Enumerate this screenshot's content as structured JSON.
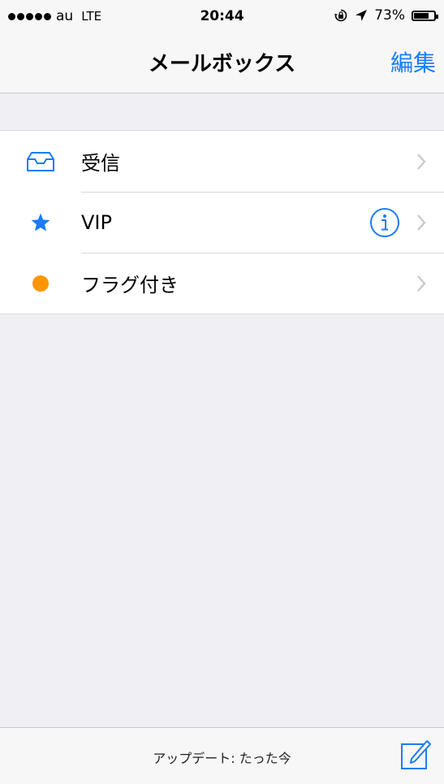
{
  "status_bar": {
    "carrier": "au",
    "network": "LTE",
    "time": "20:44",
    "battery_percent": "73%",
    "battery_level": 0.73
  },
  "nav": {
    "title": "メールボックス",
    "edit_label": "編集"
  },
  "mailboxes": [
    {
      "label": "受信",
      "icon": "inbox-tray-icon"
    },
    {
      "label": "VIP",
      "icon": "star-icon"
    },
    {
      "label": "フラグ付き",
      "icon": "orange-dot-icon"
    }
  ],
  "toolbar": {
    "status_text": "アップデート: たった今"
  },
  "colors": {
    "accent": "#1a7cf9",
    "flag": "#ff9500",
    "background": "#efeff4",
    "chevron": "#c7c7cc"
  }
}
